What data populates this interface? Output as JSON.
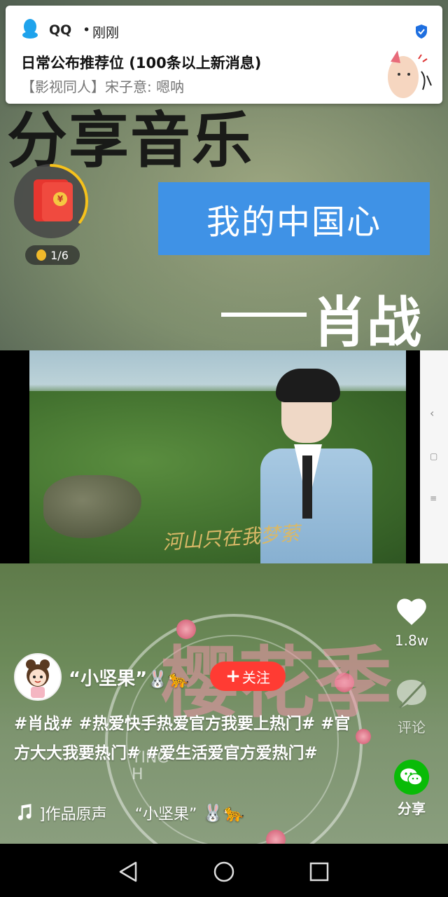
{
  "notification": {
    "app": "QQ",
    "separator": "•",
    "time": "刚刚",
    "title": "日常公布推荐位 (100条以上新消息)",
    "body": "【影视同人】宋子意: 嗯呐"
  },
  "video": {
    "background_title": "分享音乐",
    "banner_text": "我的中国心",
    "artist_text": "肖战",
    "subtitle": "河山只在我梦萦",
    "watermark_text": "樱花季",
    "watermark_small": "YING\nH"
  },
  "red_packet": {
    "coin_symbol": "¥",
    "progress_text": "1/6",
    "progress_fraction": 0.35
  },
  "actions": {
    "like_count": "1.8w",
    "comment_label": "评论",
    "share_label": "分享"
  },
  "author": {
    "name": "“小坚果”",
    "emoji": "🐰🐆",
    "follow_label": "关注",
    "follow_plus": "+"
  },
  "caption": "#肖战# #热爱快手热爱官方我要上热门# #官方大大我要热门# #爱生活爱官方爱热门#",
  "music": {
    "text": "]作品原声",
    "author": "“小坚果”",
    "emoji": "🐰🐆"
  },
  "colors": {
    "follow_bg": "#ff3b33",
    "banner_bg": "#3f92e6",
    "wechat_green": "#09bb07"
  }
}
